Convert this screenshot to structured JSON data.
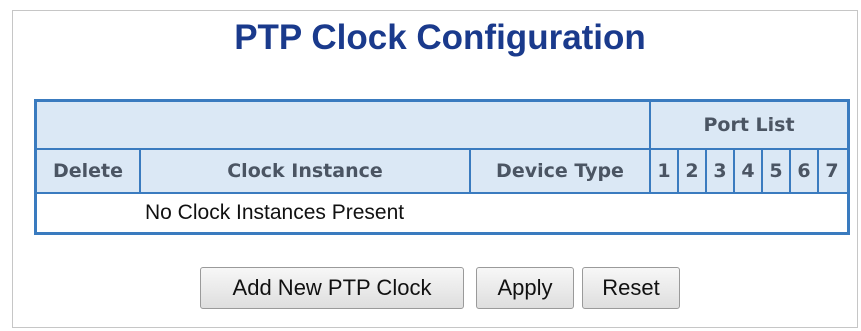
{
  "page": {
    "title": "PTP Clock Configuration"
  },
  "table": {
    "group_header": "Port List",
    "headers": {
      "delete": "Delete",
      "clock_instance": "Clock Instance",
      "device_type": "Device Type"
    },
    "ports": [
      "1",
      "2",
      "3",
      "4",
      "5",
      "6",
      "7"
    ],
    "empty_message": "No Clock Instances Present"
  },
  "buttons": {
    "add": "Add New PTP Clock",
    "apply": "Apply",
    "reset": "Reset"
  },
  "colors": {
    "title": "#1a3a8c",
    "table_border": "#3a7bbf",
    "header_bg": "#dbe8f5",
    "header_text": "#4b5563"
  }
}
